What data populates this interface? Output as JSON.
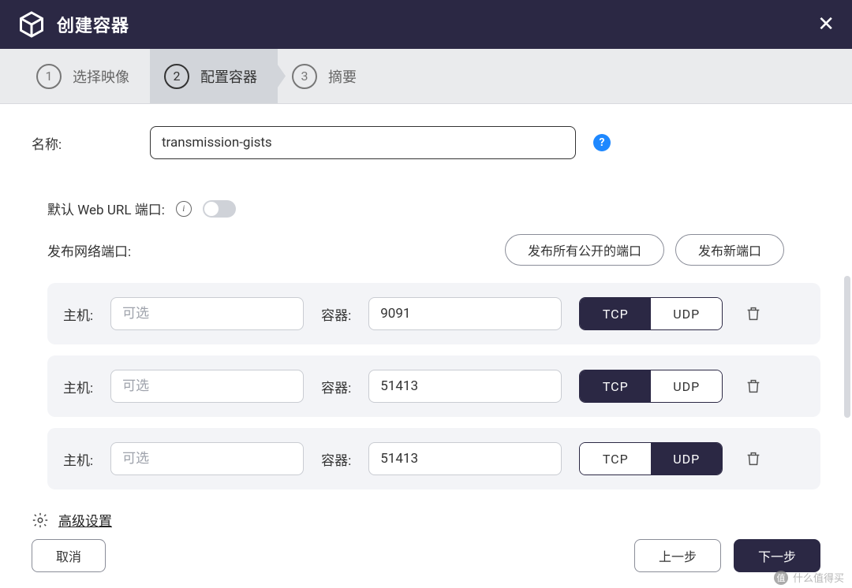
{
  "titlebar": {
    "title": "创建容器"
  },
  "steps": [
    {
      "num": "1",
      "label": "选择映像"
    },
    {
      "num": "2",
      "label": "配置容器"
    },
    {
      "num": "3",
      "label": "摘要"
    }
  ],
  "form": {
    "name_label": "名称:",
    "name_value": "transmission-gists",
    "default_port_label": "默认 Web URL 端口:",
    "publish_label": "发布网络端口:",
    "publish_all_btn": "发布所有公开的端口",
    "publish_new_btn": "发布新端口"
  },
  "port_labels": {
    "host": "主机:",
    "container": "容器:",
    "host_placeholder": "可选",
    "tcp": "TCP",
    "udp": "UDP"
  },
  "ports": [
    {
      "host": "",
      "container": "9091",
      "proto": "TCP"
    },
    {
      "host": "",
      "container": "51413",
      "proto": "TCP"
    },
    {
      "host": "",
      "container": "51413",
      "proto": "UDP"
    }
  ],
  "advanced_label": "高级设置",
  "footer": {
    "cancel": "取消",
    "prev": "上一步",
    "next": "下一步"
  },
  "watermark": "什么值得买"
}
